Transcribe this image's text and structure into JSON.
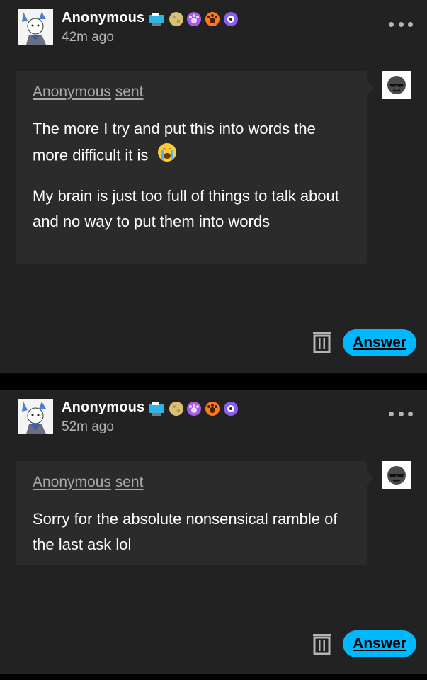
{
  "posts": [
    {
      "username": "Anonymous",
      "time": "42m ago",
      "sender_name": "Anonymous",
      "sender_sent": "sent",
      "paragraphs": [
        "The more I try and put this into words the more difficult it is",
        "My brain is just too full of things to talk about and no way to put them into words"
      ],
      "emoji_icon": "loudly-crying-face-icon",
      "answer_label": "Answer"
    },
    {
      "username": "Anonymous",
      "time": "52m ago",
      "sender_name": "Anonymous",
      "sender_sent": "sent",
      "paragraphs": [
        "Sorry for the absolute nonsensical ramble of the last ask lol"
      ],
      "answer_label": "Answer"
    }
  ],
  "colors": {
    "background": "#000000",
    "card": "#222222",
    "bubble": "#2b2b2b",
    "accent": "#00b8ff",
    "muted_text": "#b5b5b5"
  },
  "badges": [
    "camera-badge-icon",
    "moon-badge-icon",
    "purple-paw-badge-icon",
    "orange-paw-badge-icon",
    "purple-cog-badge-icon"
  ]
}
